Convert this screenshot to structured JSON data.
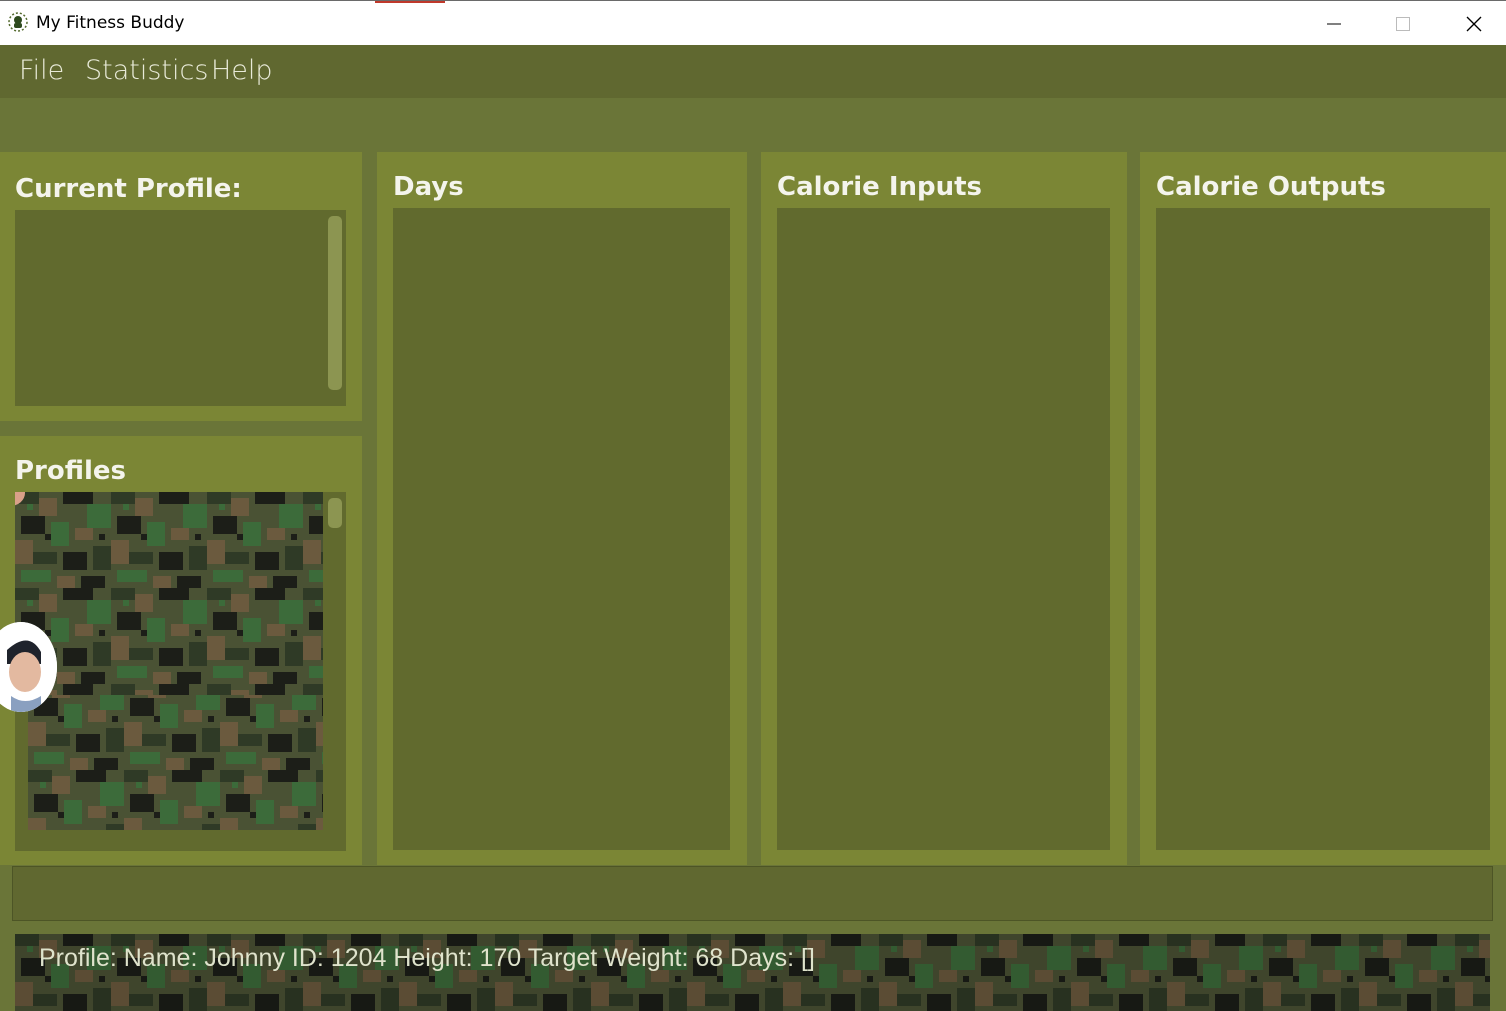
{
  "window": {
    "title": "My Fitness Buddy",
    "app_icon": "fitness-buddy-logo-icon",
    "controls": [
      "minimize-icon",
      "maximize-icon",
      "close-icon"
    ]
  },
  "menu": {
    "items": [
      {
        "label": "File"
      },
      {
        "label": "Statistics"
      },
      {
        "label": "Help"
      }
    ]
  },
  "panels": {
    "current_profile": {
      "title": "Current Profile:"
    },
    "profiles": {
      "title": "Profiles"
    },
    "days": {
      "title": "Days"
    },
    "calorie_inputs": {
      "title": "Calorie Inputs"
    },
    "calorie_outputs": {
      "title": "Calorie Outputs"
    }
  },
  "command": {
    "value": ""
  },
  "status": {
    "text": "Profile:  Name: Johnny ID: 1204 Height: 170 Target Weight: 68 Days: []"
  },
  "colors": {
    "background": "#6a7538",
    "menubar": "#606830",
    "panel": "#7b8635",
    "list": "#616a2e",
    "text": "#f4f4ec"
  }
}
